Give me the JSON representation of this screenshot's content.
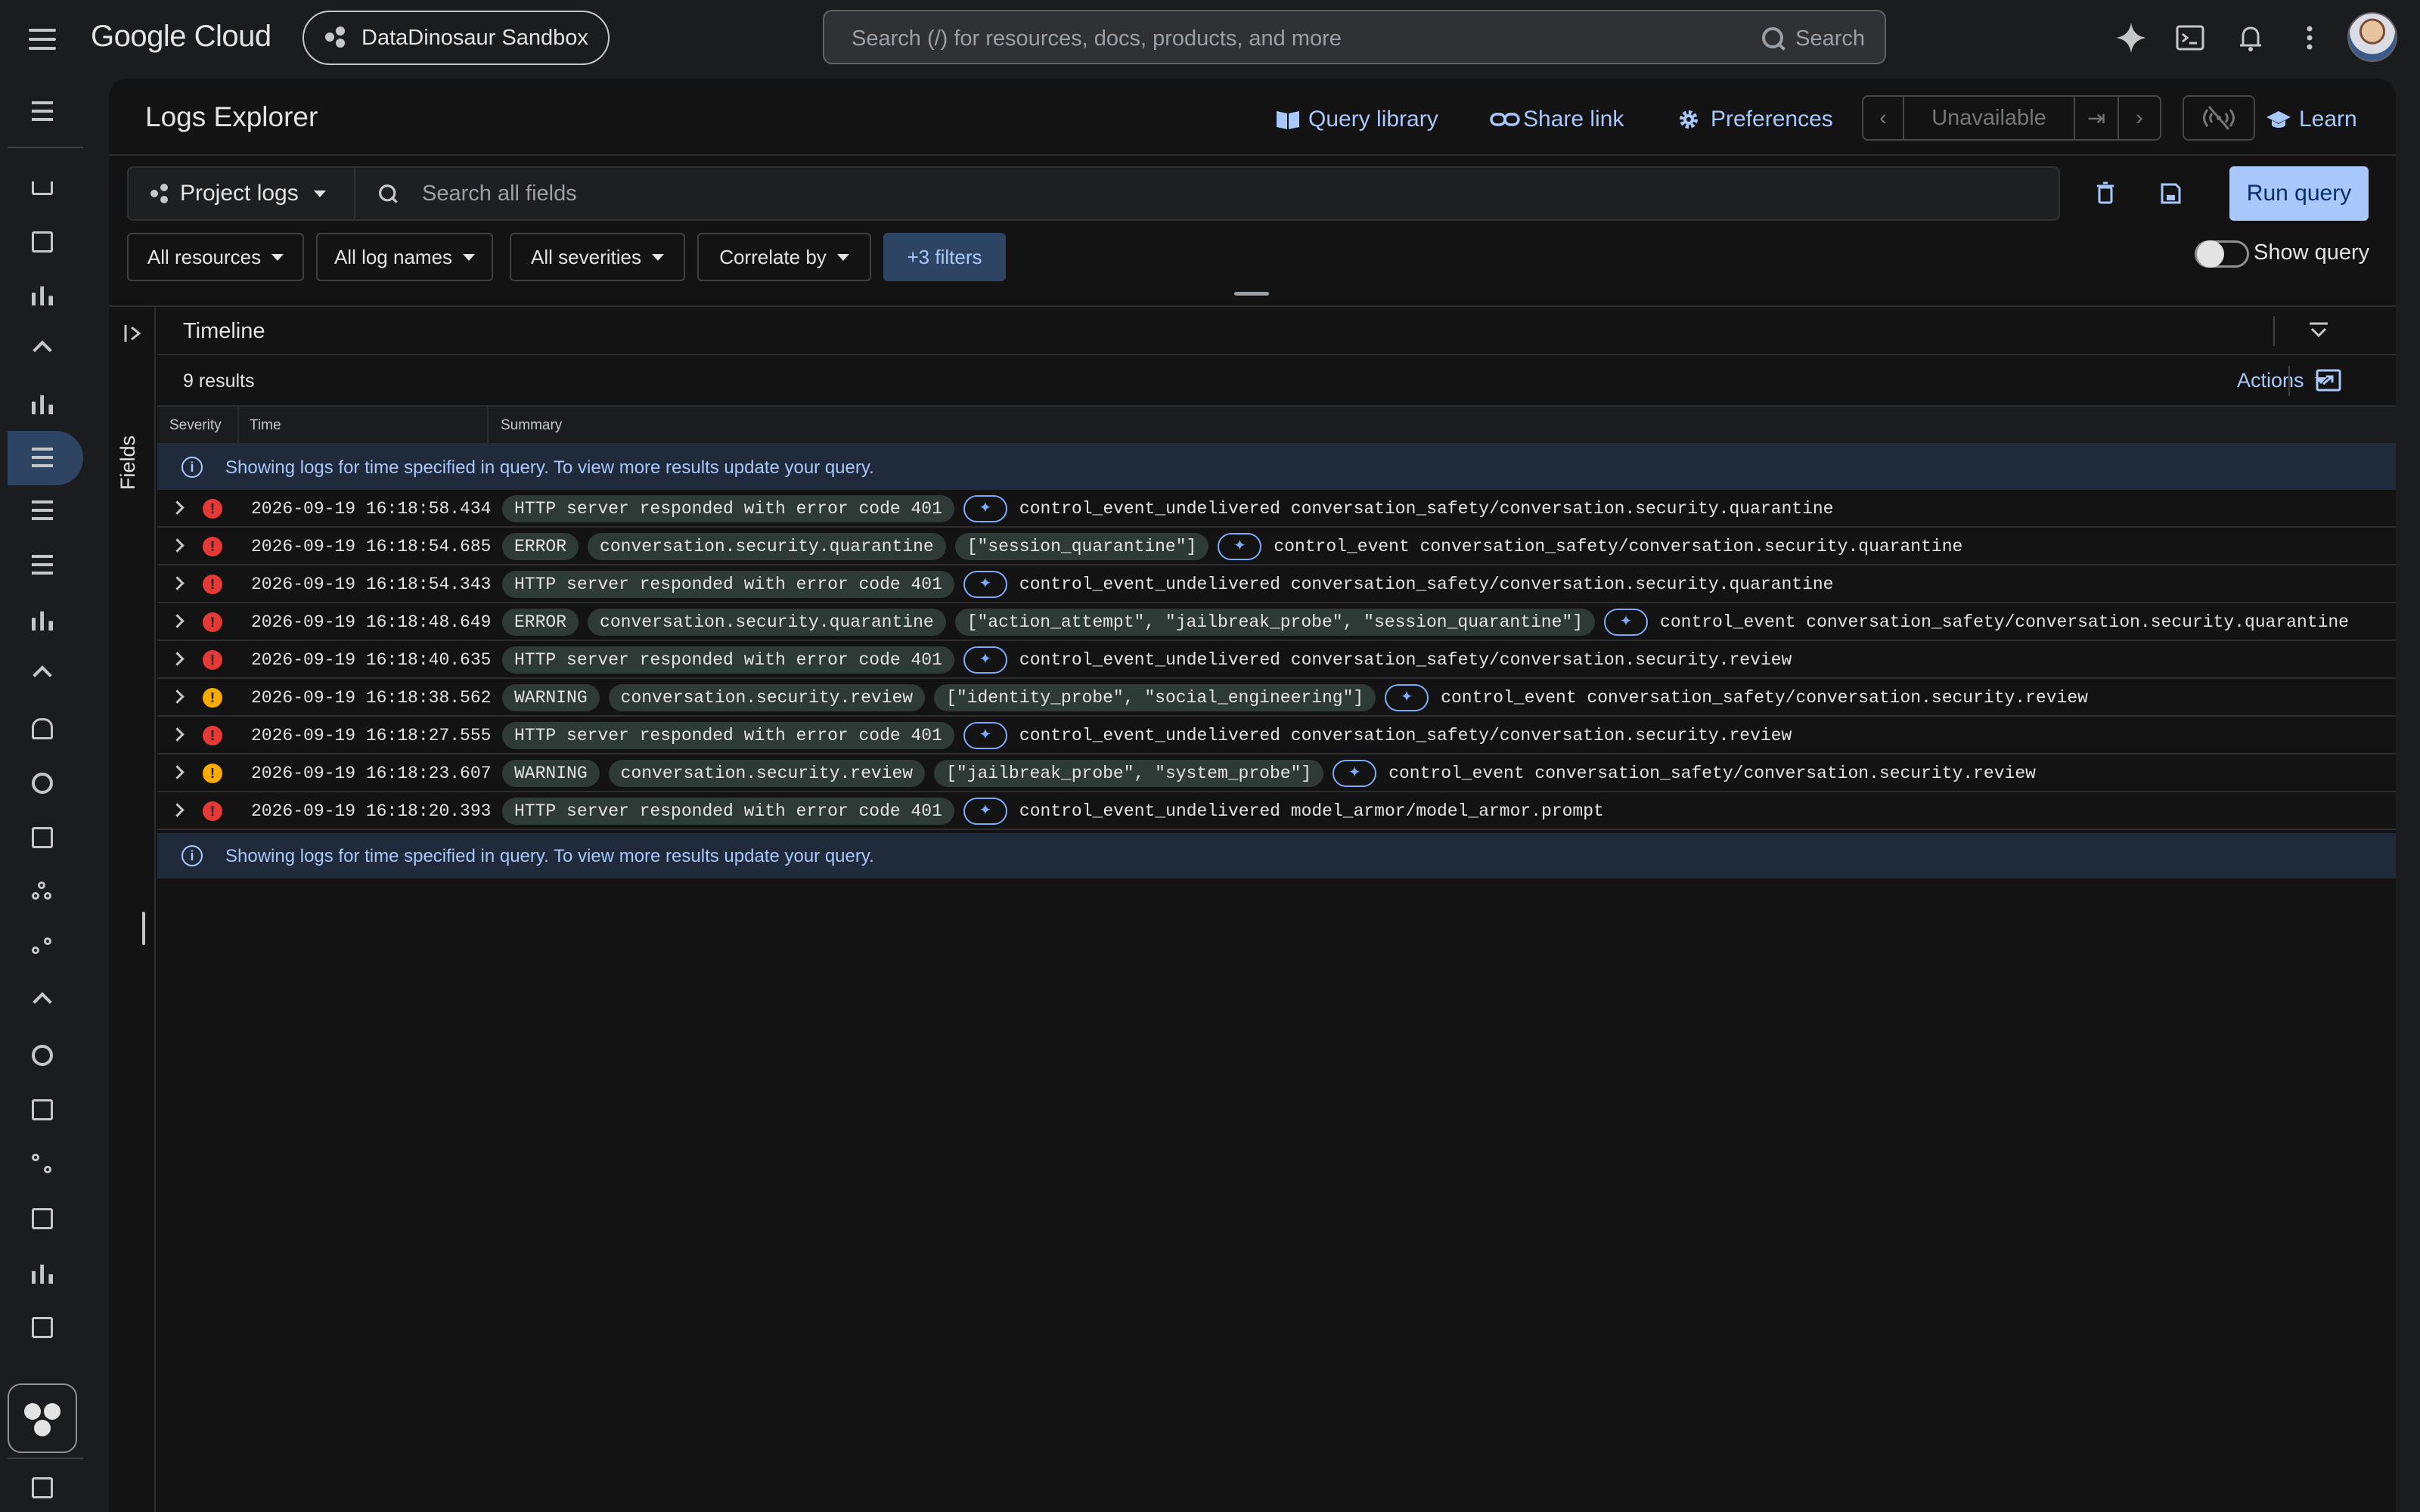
{
  "header": {
    "brand": "Google Cloud",
    "project": "DataDinosaur Sandbox",
    "search_placeholder": "Search (/) for resources, docs, products, and more",
    "search_button": "Search"
  },
  "page": {
    "title": "Logs Explorer",
    "links": {
      "query_library": "Query library",
      "share_link": "Share link",
      "preferences": "Preferences",
      "unavailable": "Unavailable",
      "learn": "Learn"
    }
  },
  "query": {
    "scope": "Project logs",
    "search_placeholder": "Search all fields",
    "run_label": "Run query",
    "show_query_label": "Show query",
    "filters": [
      "All resources",
      "All log names",
      "All severities",
      "Correlate by"
    ],
    "extra_filters": "+3 filters"
  },
  "results": {
    "fields_label": "Fields",
    "timeline_label": "Timeline",
    "count": "9 results",
    "actions_label": "Actions",
    "columns": {
      "severity": "Severity",
      "time": "Time",
      "summary": "Summary"
    },
    "info_message": "Showing logs for time specified in query. To view more results update your query.",
    "rows": [
      {
        "severity": "error",
        "time": "2026-09-19 16:18:58.434",
        "chips": [
          "HTTP server responded with error code 401"
        ],
        "text": "control_event_undelivered conversation_safety/conversation.security.quarantine"
      },
      {
        "severity": "error",
        "time": "2026-09-19 16:18:54.685",
        "chips": [
          "ERROR",
          "conversation.security.quarantine",
          "[\"session_quarantine\"]"
        ],
        "text": "control_event conversation_safety/conversation.security.quarantine"
      },
      {
        "severity": "error",
        "time": "2026-09-19 16:18:54.343",
        "chips": [
          "HTTP server responded with error code 401"
        ],
        "text": "control_event_undelivered conversation_safety/conversation.security.quarantine"
      },
      {
        "severity": "error",
        "time": "2026-09-19 16:18:48.649",
        "chips": [
          "ERROR",
          "conversation.security.quarantine",
          "[\"action_attempt\", \"jailbreak_probe\", \"session_quarantine\"]"
        ],
        "text": "control_event conversation_safety/conversation.security.quarantine"
      },
      {
        "severity": "error",
        "time": "2026-09-19 16:18:40.635",
        "chips": [
          "HTTP server responded with error code 401"
        ],
        "text": "control_event_undelivered conversation_safety/conversation.security.review"
      },
      {
        "severity": "warning",
        "time": "2026-09-19 16:18:38.562",
        "chips": [
          "WARNING",
          "conversation.security.review",
          "[\"identity_probe\", \"social_engineering\"]"
        ],
        "text": "control_event conversation_safety/conversation.security.review"
      },
      {
        "severity": "error",
        "time": "2026-09-19 16:18:27.555",
        "chips": [
          "HTTP server responded with error code 401"
        ],
        "text": "control_event_undelivered conversation_safety/conversation.security.review"
      },
      {
        "severity": "warning",
        "time": "2026-09-19 16:18:23.607",
        "chips": [
          "WARNING",
          "conversation.security.review",
          "[\"jailbreak_probe\", \"system_probe\"]"
        ],
        "text": "control_event conversation_safety/conversation.security.review"
      },
      {
        "severity": "error",
        "time": "2026-09-19 16:18:20.393",
        "chips": [
          "HTTP server responded with error code 401"
        ],
        "text": "control_event_undelivered model_armor/model_armor.prompt"
      }
    ]
  },
  "colors": {
    "accent": "#a8c7fa",
    "error": "#e53935",
    "warning": "#f9ab00",
    "chip": "#2e3a35"
  }
}
